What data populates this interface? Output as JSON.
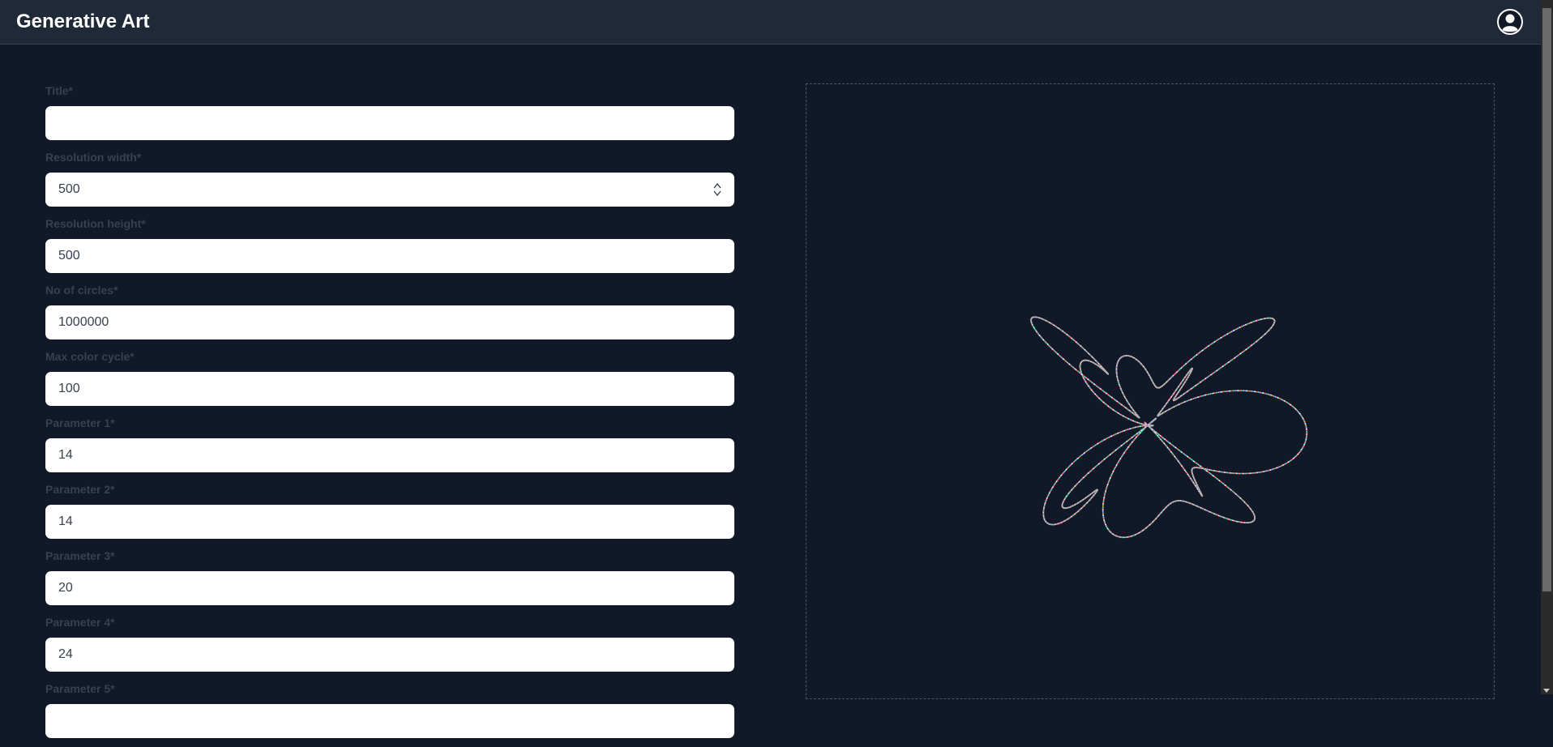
{
  "app": {
    "title": "Generative Art"
  },
  "header": {
    "profile_icon": "user-circle-icon"
  },
  "form": {
    "fields": [
      {
        "label": "Title*",
        "value": "",
        "type": "text"
      },
      {
        "label": "Resolution width*",
        "value": "500",
        "type": "number"
      },
      {
        "label": "Resolution height*",
        "value": "500",
        "type": "number"
      },
      {
        "label": "No of circles*",
        "value": "1000000",
        "type": "number"
      },
      {
        "label": "Max color cycle*",
        "value": "100",
        "type": "number"
      },
      {
        "label": "Parameter 1*",
        "value": "14",
        "type": "number"
      },
      {
        "label": "Parameter 2*",
        "value": "14",
        "type": "number"
      },
      {
        "label": "Parameter 3*",
        "value": "20",
        "type": "number"
      },
      {
        "label": "Parameter 4*",
        "value": "24",
        "type": "number"
      },
      {
        "label": "Parameter 5*",
        "value": "",
        "type": "number"
      }
    ]
  },
  "colors": {
    "background": "#111827",
    "header": "#1f2937",
    "label": "#374151",
    "input_bg": "#ffffff"
  }
}
